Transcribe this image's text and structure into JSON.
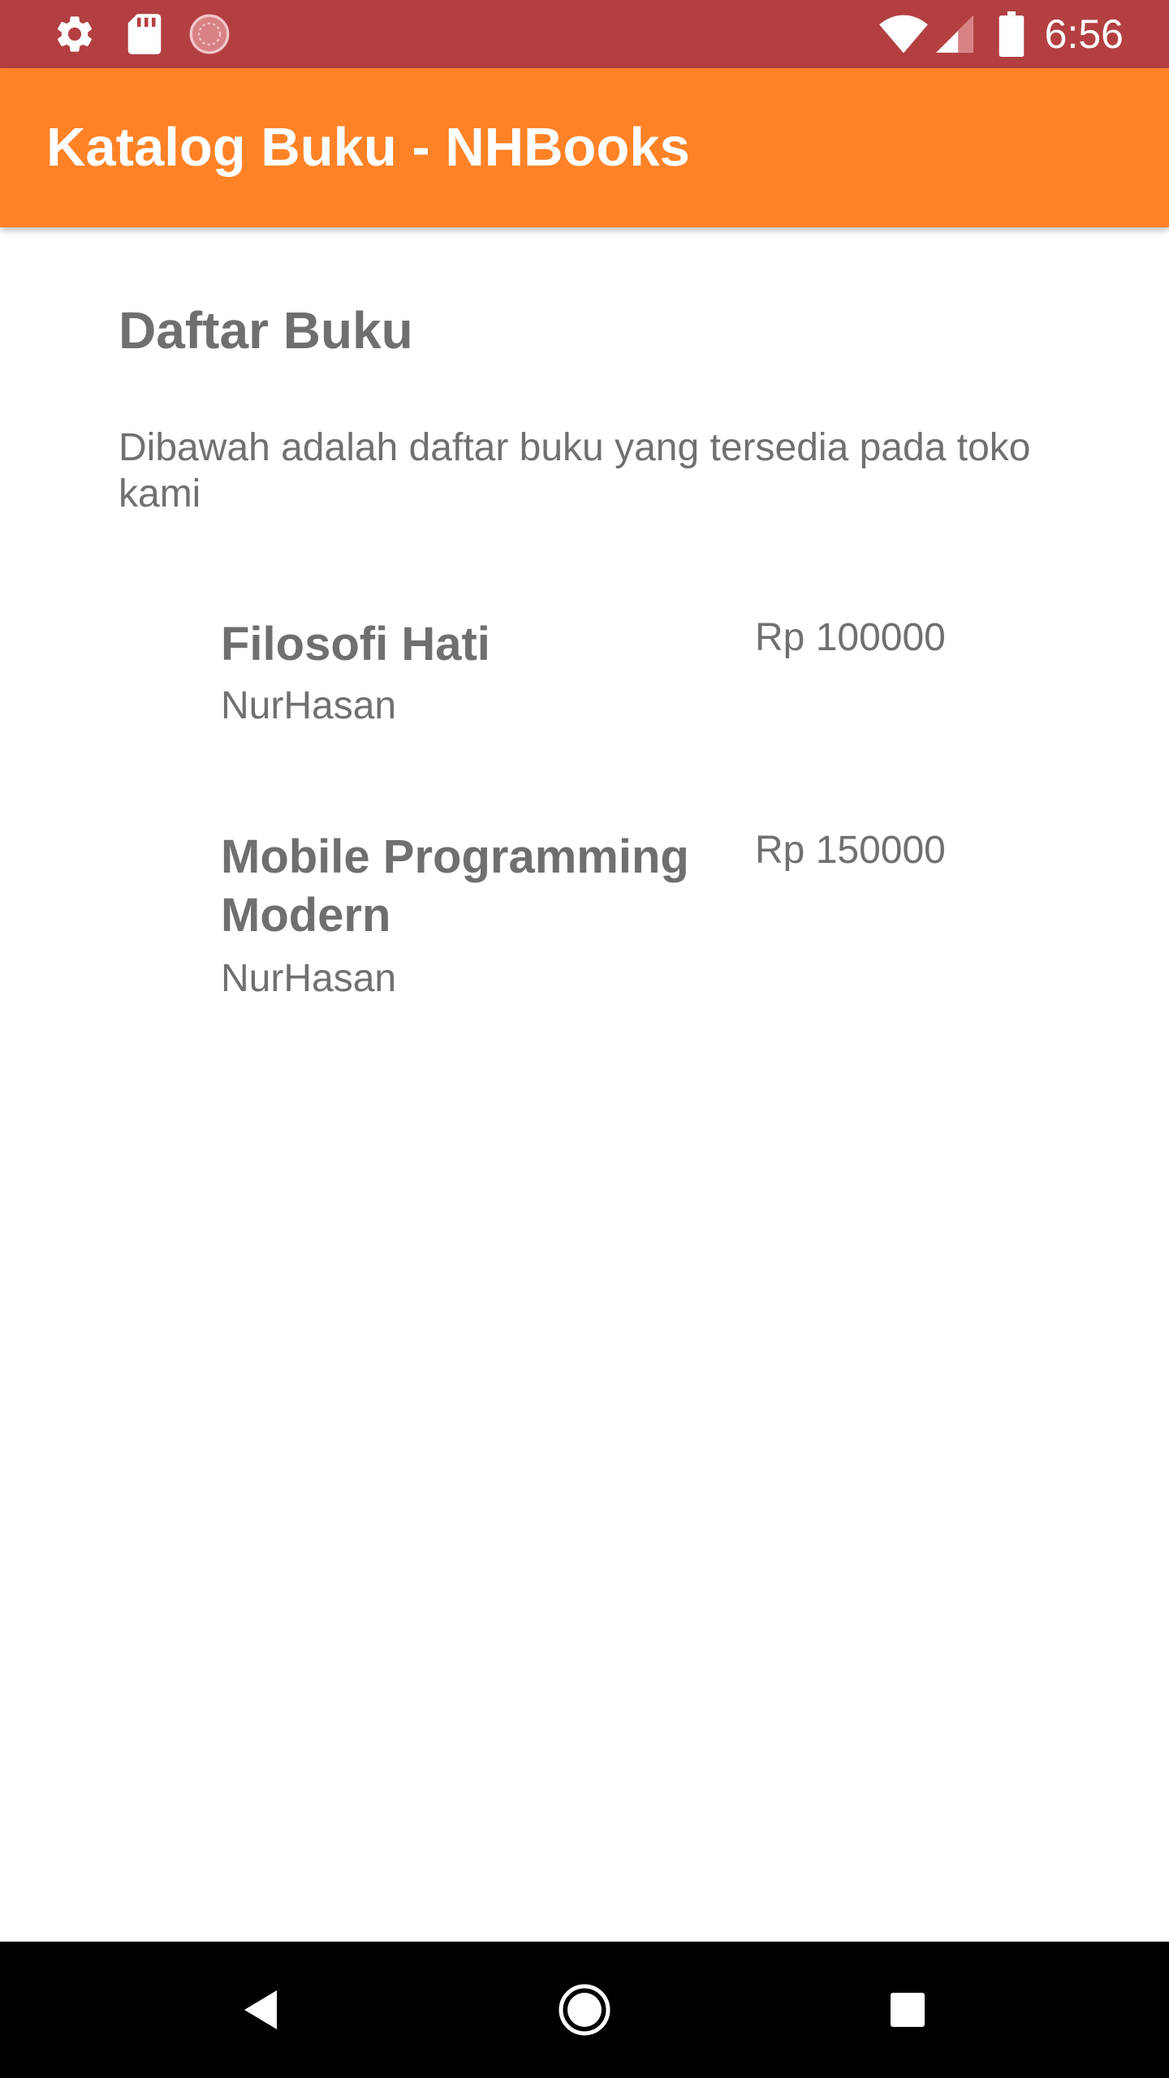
{
  "status_bar": {
    "time": "6:56",
    "left_icons": [
      "gear-icon",
      "sd-card-icon",
      "loading-circle-icon"
    ],
    "right_icons": [
      "wifi-icon",
      "signal-icon",
      "battery-icon"
    ],
    "color": "#b33f41"
  },
  "app_bar": {
    "title": "Katalog Buku - NHBooks",
    "color": "#ff8226"
  },
  "main": {
    "title": "Daftar Buku",
    "description": "Dibawah adalah daftar buku yang tersedia pada toko kami",
    "books": [
      {
        "title": "Filosofi Hati",
        "author": "NurHasan",
        "price": "Rp 100000"
      },
      {
        "title": "Mobile Programming Modern",
        "author": "NurHasan",
        "price": "Rp 150000"
      }
    ]
  },
  "nav_bar": {
    "buttons": [
      "back-icon",
      "home-icon",
      "recents-icon"
    ]
  }
}
